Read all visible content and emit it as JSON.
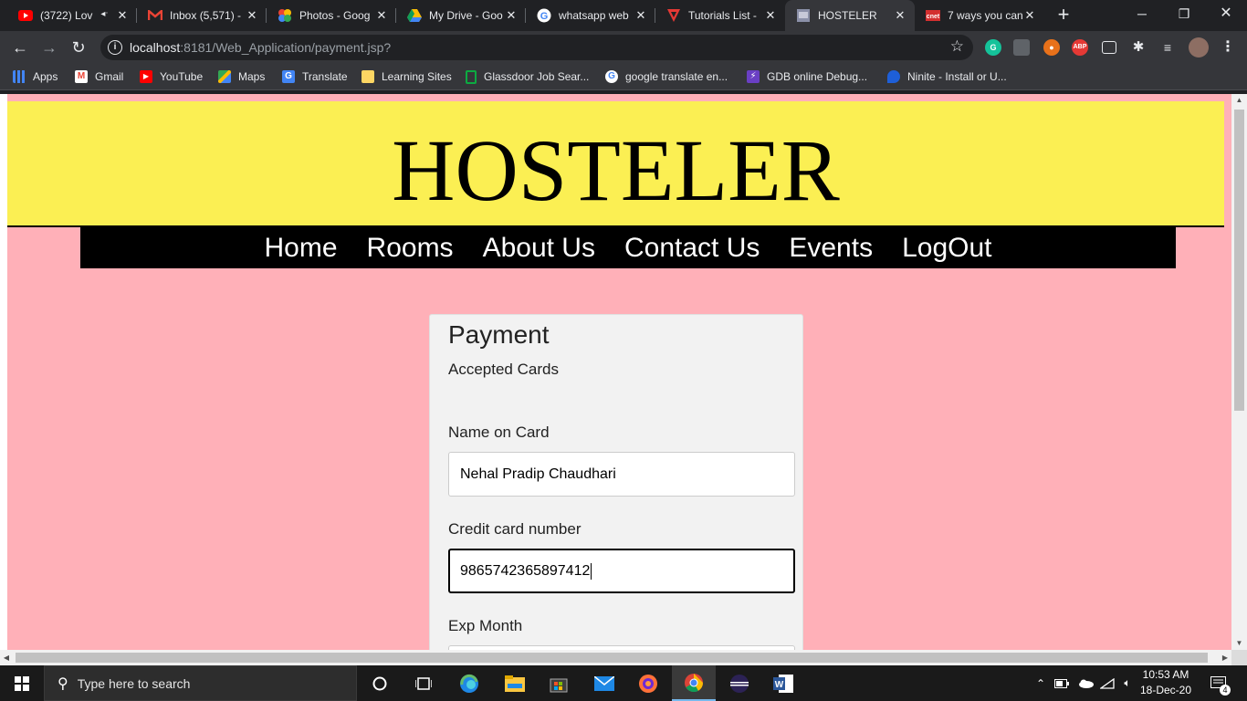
{
  "browser": {
    "tabs": [
      {
        "title": "(3722) Lov",
        "icon": "youtube-icon"
      },
      {
        "title": "Inbox (5,571) -",
        "icon": "gmail-icon"
      },
      {
        "title": "Photos - Goog",
        "icon": "google-photos-icon"
      },
      {
        "title": "My Drive - Goo",
        "icon": "google-drive-icon"
      },
      {
        "title": "whatsapp web",
        "icon": "google-icon"
      },
      {
        "title": "Tutorials List -",
        "icon": "tutorials-icon"
      },
      {
        "title": "HOSTELER",
        "icon": "page-icon"
      },
      {
        "title": "7 ways you can",
        "icon": "cnet-icon"
      }
    ],
    "url_host": "localhost",
    "url_rest": ":8181/Web_Application/payment.jsp?",
    "bookmarks": [
      {
        "label": "Apps",
        "icon": "apps-grid-icon"
      },
      {
        "label": "Gmail",
        "icon": "gmail-icon"
      },
      {
        "label": "YouTube",
        "icon": "youtube-icon"
      },
      {
        "label": "Maps",
        "icon": "maps-icon"
      },
      {
        "label": "Translate",
        "icon": "translate-icon"
      },
      {
        "label": "Learning Sites",
        "icon": "folder-icon"
      },
      {
        "label": "Glassdoor Job Sear...",
        "icon": "glassdoor-icon"
      },
      {
        "label": "google translate en...",
        "icon": "google-icon"
      },
      {
        "label": "GDB online Debug...",
        "icon": "gdb-icon"
      },
      {
        "label": "Ninite - Install or U...",
        "icon": "ninite-icon"
      }
    ]
  },
  "site": {
    "title": "HOSTELER",
    "nav": [
      "Home",
      "Rooms",
      "About Us",
      "Contact Us",
      "Events",
      "LogOut"
    ]
  },
  "payment": {
    "heading": "Payment",
    "accepted_cards_label": "Accepted Cards",
    "name_label": "Name on Card",
    "name_value": "Nehal Pradip Chaudhari",
    "card_label": "Credit card number",
    "card_value": "9865742365897412",
    "exp_month_label": "Exp Month"
  },
  "taskbar": {
    "search_placeholder": "Type here to search",
    "time": "10:53 AM",
    "date": "18-Dec-20",
    "notifications": "4"
  },
  "colors": {
    "banner": "#fbef53",
    "page_bg": "#ffb0b8",
    "nav_bg": "#000000"
  }
}
